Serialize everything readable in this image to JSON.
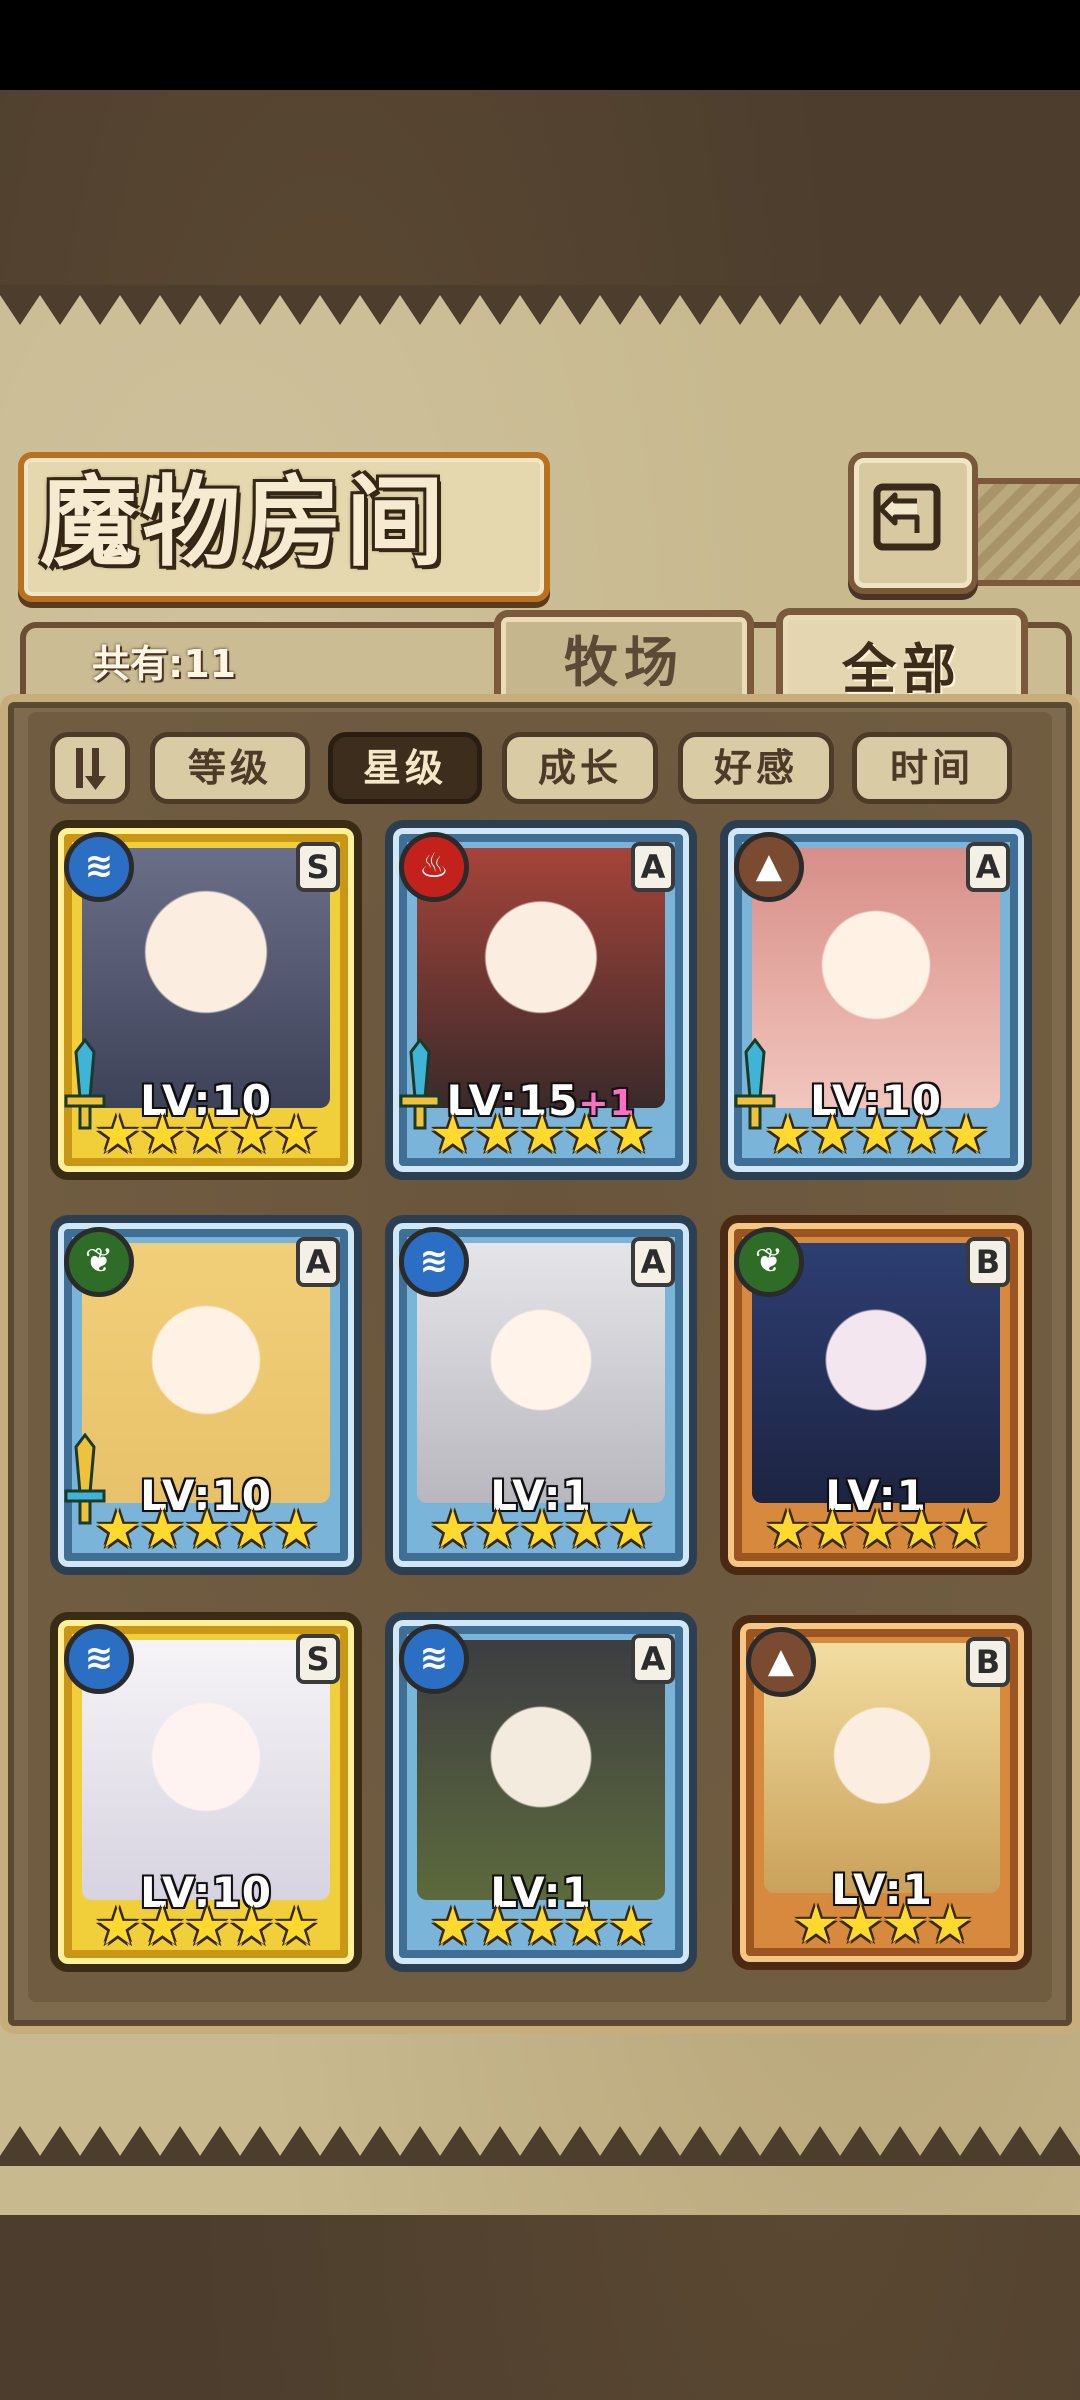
{
  "header": {
    "title": "魔物房间",
    "back_icon": "return-arrow-icon"
  },
  "summary": {
    "count_label": "共有:11"
  },
  "tabs": [
    {
      "label": "牧场",
      "active": false
    },
    {
      "label": "全部",
      "active": true
    }
  ],
  "sort": {
    "toggle_icon": "sort-order-icon",
    "options": [
      {
        "label": "等级",
        "active": false
      },
      {
        "label": "星级",
        "active": true
      },
      {
        "label": "成长",
        "active": false
      },
      {
        "label": "好感",
        "active": false
      },
      {
        "label": "时间",
        "active": false
      }
    ]
  },
  "monsters": [
    {
      "element": "water",
      "element_icon": "water-element-icon",
      "rank": "S",
      "frame": "gold",
      "level": "LV:10",
      "bonus": "",
      "stars": "★★★★★",
      "star_count": 5,
      "equipped_weapon": true
    },
    {
      "element": "fire",
      "element_icon": "fire-element-icon",
      "rank": "A",
      "frame": "blue",
      "level": "LV:15",
      "bonus": "+1",
      "stars": "★★★★★",
      "star_count": 5,
      "equipped_weapon": true
    },
    {
      "element": "earth",
      "element_icon": "earth-element-icon",
      "rank": "A",
      "frame": "blue",
      "level": "LV:10",
      "bonus": "",
      "stars": "★★★★★",
      "star_count": 5,
      "equipped_weapon": true
    },
    {
      "element": "grass",
      "element_icon": "grass-element-icon",
      "rank": "A",
      "frame": "blue",
      "level": "LV:10",
      "bonus": "",
      "stars": "★★★★★",
      "star_count": 5,
      "equipped_weapon": true
    },
    {
      "element": "water",
      "element_icon": "water-element-icon",
      "rank": "A",
      "frame": "blue",
      "level": "LV:1",
      "bonus": "",
      "stars": "★★★★★",
      "star_count": 5,
      "equipped_weapon": false
    },
    {
      "element": "grass",
      "element_icon": "grass-element-icon",
      "rank": "B",
      "frame": "bronze",
      "level": "LV:1",
      "bonus": "",
      "stars": "★★★★★",
      "star_count": 5,
      "equipped_weapon": false
    },
    {
      "element": "water",
      "element_icon": "water-element-icon",
      "rank": "S",
      "frame": "gold",
      "level": "LV:10",
      "bonus": "",
      "stars": "★★★★★",
      "star_count": 5,
      "equipped_weapon": false
    },
    {
      "element": "water",
      "element_icon": "water-element-icon",
      "rank": "A",
      "frame": "blue",
      "level": "LV:1",
      "bonus": "",
      "stars": "★★★★★",
      "star_count": 5,
      "equipped_weapon": false
    },
    {
      "element": "earth",
      "element_icon": "earth-element-icon",
      "rank": "B",
      "frame": "bronze",
      "level": "LV:1",
      "bonus": "",
      "stars": "★★★★",
      "star_count": 4,
      "equipped_weapon": false
    }
  ]
}
